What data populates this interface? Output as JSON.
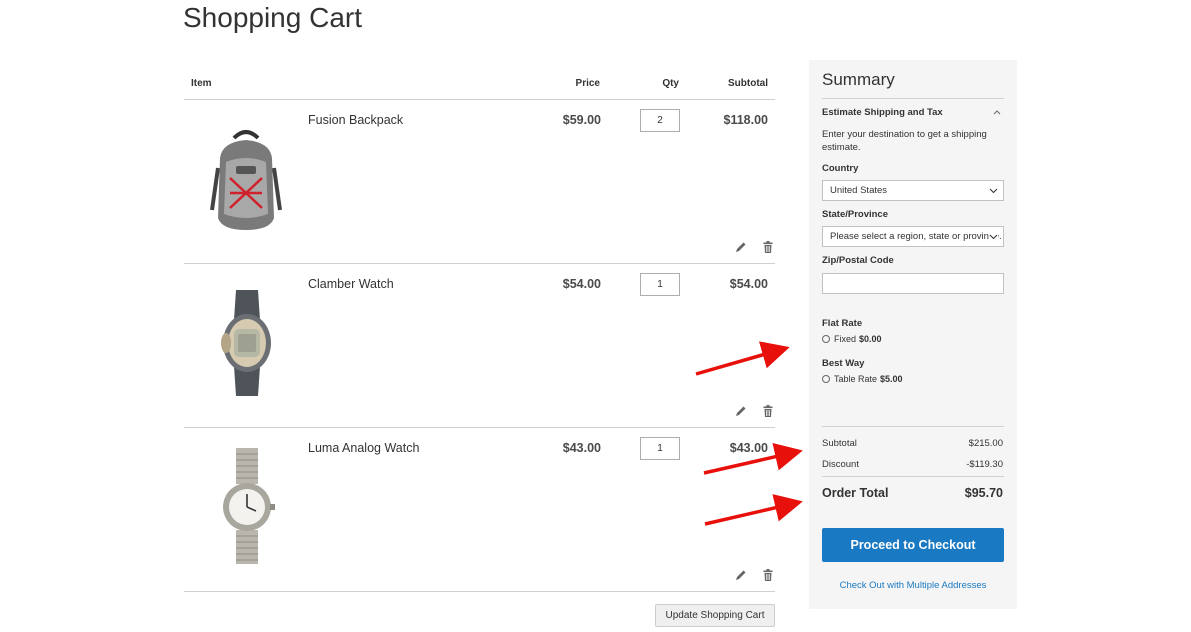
{
  "page": {
    "title": "Shopping Cart"
  },
  "cart": {
    "headers": {
      "item": "Item",
      "price": "Price",
      "qty": "Qty",
      "subtotal": "Subtotal"
    },
    "items": [
      {
        "name": "Fusion Backpack",
        "price": "$59.00",
        "qty": "2",
        "subtotal": "$118.00",
        "image": "backpack-image"
      },
      {
        "name": "Clamber Watch",
        "price": "$54.00",
        "qty": "1",
        "subtotal": "$54.00",
        "image": "sport-watch-image"
      },
      {
        "name": "Luma Analog Watch",
        "price": "$43.00",
        "qty": "1",
        "subtotal": "$43.00",
        "image": "analog-watch-image"
      }
    ],
    "update_label": "Update Shopping Cart"
  },
  "summary": {
    "title": "Summary",
    "estimate_title": "Estimate Shipping and Tax",
    "estimate_desc": "Enter your destination to get a shipping estimate.",
    "country_label": "Country",
    "country_value": "United States",
    "state_label": "State/Province",
    "state_value": "Please select a region, state or province.",
    "zip_label": "Zip/Postal Code",
    "zip_value": "",
    "rates": [
      {
        "carrier": "Flat Rate",
        "method": "Fixed",
        "amount": "$0.00"
      },
      {
        "carrier": "Best Way",
        "method": "Table Rate",
        "amount": "$5.00"
      }
    ],
    "subtotal_label": "Subtotal",
    "subtotal_value": "$215.00",
    "discount_label": "Discount",
    "discount_value": "-$119.30",
    "order_total_label": "Order Total",
    "order_total_value": "$95.70",
    "checkout_label": "Proceed to Checkout",
    "multi_label": "Check Out with Multiple Addresses"
  },
  "colors": {
    "accent": "#1979c3",
    "annotation": "#e8100b",
    "summary_bg": "#f5f5f5"
  }
}
